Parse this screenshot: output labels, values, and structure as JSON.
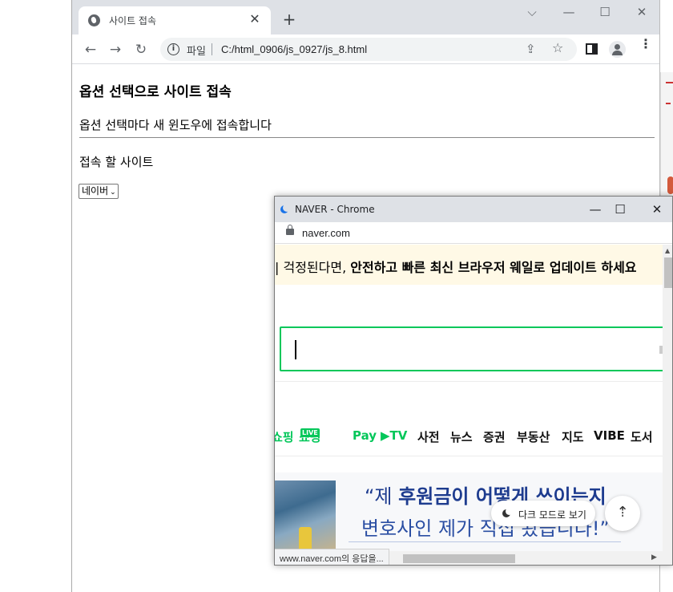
{
  "browser": {
    "tab_title": "사이트 접속",
    "new_tab": "+",
    "window_controls": {
      "dropdown": "⌵",
      "minimize": "—",
      "maximize": "☐",
      "close": "✕"
    },
    "nav": {
      "back": "←",
      "forward": "→",
      "reload": "↻"
    },
    "address": {
      "scheme_label": "파일",
      "url": "C:/html_0906/js_0927/js_8.html"
    },
    "icons": {
      "info": "i",
      "share": "⇪",
      "bookmark": "☆",
      "menu": "⋮",
      "tab_close": "✕"
    }
  },
  "page": {
    "heading": "옵션 선택으로 사이트 접속",
    "description": "옵션 선택마다 새 윈도우에 접속합니다",
    "select_label": "접속 할 사이트",
    "select_value": "네이버",
    "select_chevron": "⌄"
  },
  "popup": {
    "title": "NAVER - Chrome",
    "controls": {
      "minimize": "—",
      "maximize": "☐",
      "close": "✕"
    },
    "url": "naver.com",
    "banner": {
      "text_plain": "| 걱정된다면, ",
      "text_bold": "안전하고 빠른 최신 브라우저 웨일로 업데이트 하세요"
    },
    "nav_items": [
      "쇼핑",
      "쇼핑",
      "Pay",
      "▶TV",
      "사전",
      "뉴스",
      "증권",
      "부동산",
      "지도",
      "VIBE",
      "도서"
    ],
    "nav_live_badge": "LIVE",
    "ad": {
      "line1_quote": "“제 ",
      "line1_bold": "후원금이 어떻게 쓰이는지",
      "line2": "변호사인 제가 직접 봤습니다!”"
    },
    "dark_mode_label": "다크 모드로 보기",
    "to_top": "⇡",
    "status_text": "www.naver.com의 응답을..."
  }
}
